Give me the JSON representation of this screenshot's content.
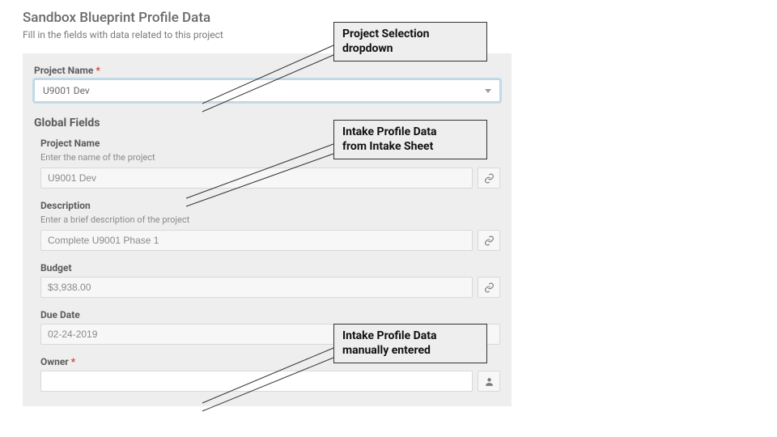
{
  "header": {
    "title": "Sandbox Blueprint Profile Data",
    "subtitle": "Fill in the fields with data related to this project"
  },
  "project": {
    "label": "Project Name",
    "required_mark": "*",
    "selected": "U9001 Dev"
  },
  "global_section_title": "Global Fields",
  "fields": {
    "project_name": {
      "label": "Project Name",
      "help": "Enter the name of the project",
      "value": "U9001 Dev"
    },
    "description": {
      "label": "Description",
      "help": "Enter a brief description of the project",
      "value": "Complete U9001 Phase 1"
    },
    "budget": {
      "label": "Budget",
      "value": "$3,938.00"
    },
    "due_date": {
      "label": "Due Date",
      "value": "02-24-2019"
    },
    "owner": {
      "label": "Owner",
      "required_mark": "*",
      "value": ""
    }
  },
  "callouts": {
    "c1_line1": "Project Selection",
    "c1_line2": "dropdown",
    "c2_line1": "Intake Profile Data",
    "c2_line2": "from Intake Sheet",
    "c3_line1": "Intake Profile Data",
    "c3_line2": "manually entered"
  }
}
